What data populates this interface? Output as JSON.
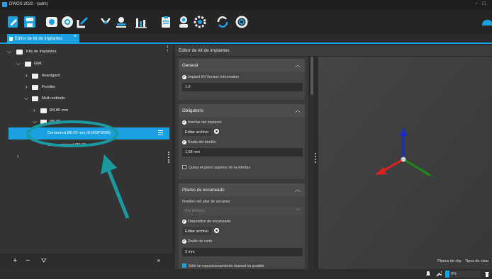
{
  "window": {
    "title": "DWOS 2020 - (adm)",
    "controls": "- □"
  },
  "toolbar": {
    "icons": [
      "edit-icon",
      "save-icon",
      "scanner-icon",
      "settings-dial-icon",
      "import-icon",
      "dental-arch-icon",
      "user-icon",
      "chart-icon",
      "clipboard-icon",
      "doctor-icon",
      "gear-icon",
      "refresh-icon",
      "help-ring-icon",
      "cloud-icon"
    ]
  },
  "tab": {
    "label": "Editor de kit de implantes",
    "close": "×"
  },
  "tree": {
    "rows": [
      {
        "label": "Kits de implantes"
      },
      {
        "label": "GMI"
      },
      {
        "label": "Avantgard"
      },
      {
        "label": "Frontier"
      },
      {
        "label": "Multi-esthetic"
      },
      {
        "label": "Ø4.80 mm"
      },
      {
        "label": "Ø6.00"
      },
      {
        "label": "Cemented Ø6.00 mm (KO00F0036)"
      },
      {
        "label": "Screw-retained Ø6.00 mm"
      }
    ],
    "bottom": {
      "add": "+",
      "remove": "−",
      "filter": "⛛",
      "close": "×"
    }
  },
  "editor": {
    "header": "Editor de kit de implantes",
    "general": {
      "title": "General",
      "field_label": "Implant Kit Version Information",
      "field_value": "1.0"
    },
    "obligatorio": {
      "title": "Obligatorio",
      "interfaz_label": "Interfaz del implante",
      "edit_button": "Editar archivo",
      "radio_label": "Radio del tornillo",
      "radio_value": "1,68 mm",
      "quitar_label": "Quitar el plano superior de la interfaz"
    },
    "pilares": {
      "title": "Pilares de escaneado",
      "nombre_label": "Nombre del pilar de escaneo",
      "nombre_placeholder": "Por defecto",
      "dispositivo_label": "Dispositivo de escaneado",
      "edit_button": "Editar archivo",
      "corte_label": "Radio de corte",
      "corte_value": "3 mm",
      "manual_label": "Sólo un reposicionamiento manual es posible"
    }
  },
  "viewport": {
    "labels": {
      "clip": "Planos de clip",
      "view": "Tipos de vista"
    },
    "zoom": "0%"
  },
  "colors": {
    "accent": "#1ba1e2",
    "annotation": "#1a9aa0",
    "axis_x": "#e02020",
    "axis_y": "#1a7a1a",
    "axis_z": "#1a2ad0"
  }
}
